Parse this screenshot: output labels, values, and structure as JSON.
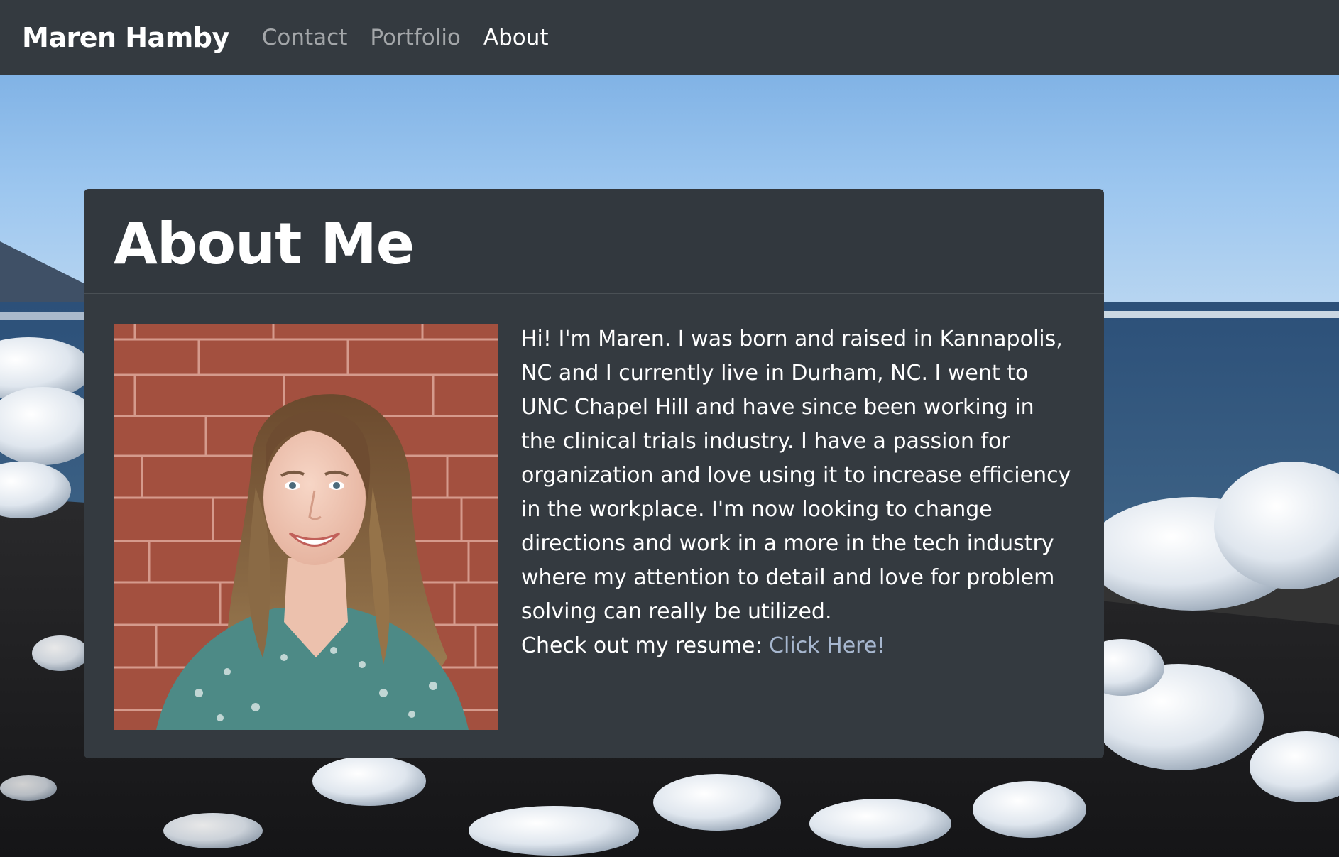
{
  "navbar": {
    "brand": "Maren Hamby",
    "links": [
      {
        "label": "Contact",
        "active": false
      },
      {
        "label": "Portfolio",
        "active": false
      },
      {
        "label": "About",
        "active": true
      }
    ]
  },
  "about": {
    "heading": "About Me",
    "bio": "Hi! I'm Maren. I was born and raised in Kannapolis, NC and I currently live in Durham, NC. I went to UNC Chapel Hill and have since been working in the clinical trials industry. I have a passion for organization and love using it to increase efficiency in the workplace. I'm now looking to change directions and work in a more in the tech industry where my attention to detail and love for problem solving can really be utilized.",
    "resume_prefix": "Check out my resume: ",
    "resume_link": "Click Here!"
  },
  "colors": {
    "navbar_bg": "#343a40",
    "card_bg": "#343a40",
    "link": "#a7b7cf",
    "nav_inactive": "rgba(255,255,255,0.55)",
    "nav_active": "#ffffff"
  },
  "images": {
    "background": "beach-ice-background-image",
    "portrait": "portrait-photo"
  }
}
